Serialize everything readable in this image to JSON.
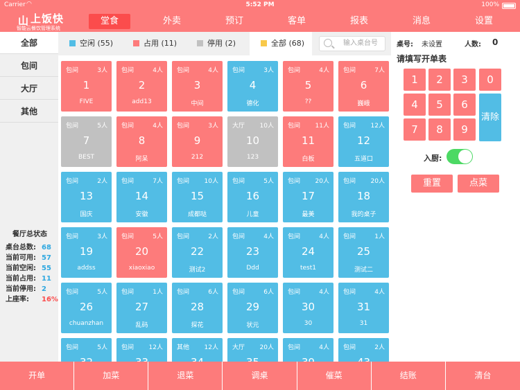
{
  "status": {
    "carrier": "Carrier",
    "time": "5:52 PM",
    "battery": "100%"
  },
  "logo": {
    "mark": "山",
    "title": "上饭快",
    "subtitle": "智能云餐饮管理系统"
  },
  "nav": [
    {
      "label": "堂食",
      "active": true
    },
    {
      "label": "外卖"
    },
    {
      "label": "预订"
    },
    {
      "label": "客单"
    },
    {
      "label": "报表"
    },
    {
      "label": "消息"
    },
    {
      "label": "设置"
    }
  ],
  "sidebar": {
    "items": [
      "全部",
      "包间",
      "大厅",
      "其他"
    ],
    "stats_title": "餐厅总状态",
    "stats": [
      {
        "label": "桌台总数:",
        "value": "68"
      },
      {
        "label": "当前可用:",
        "value": "57"
      },
      {
        "label": "当前空闲:",
        "value": "55"
      },
      {
        "label": "当前占用:",
        "value": "11"
      },
      {
        "label": "当前停用:",
        "value": "2"
      },
      {
        "label": "上座率:",
        "value": "16%"
      }
    ]
  },
  "filters": [
    {
      "label": "空闲 (55)",
      "color": "#52bde5"
    },
    {
      "label": "占用 (11)",
      "color": "#fd7b7b"
    },
    {
      "label": "停用 (2)",
      "color": "#c1c1c1"
    },
    {
      "label": "全部 (68)",
      "color": "#f8c94a"
    }
  ],
  "search": {
    "placeholder": "输入桌台号"
  },
  "tables": [
    {
      "kind": "包间",
      "seats": "3人",
      "num": "1",
      "name": "FIVE",
      "status": "busy"
    },
    {
      "kind": "包间",
      "seats": "4人",
      "num": "2",
      "name": "add13",
      "status": "busy"
    },
    {
      "kind": "包间",
      "seats": "4人",
      "num": "3",
      "name": "中间",
      "status": "busy"
    },
    {
      "kind": "包间",
      "seats": "3人",
      "num": "4",
      "name": "德化",
      "status": "free"
    },
    {
      "kind": "包间",
      "seats": "4人",
      "num": "5",
      "name": "??",
      "status": "busy"
    },
    {
      "kind": "包间",
      "seats": "7人",
      "num": "6",
      "name": "巍峨",
      "status": "busy"
    },
    {
      "kind": "包间",
      "seats": "5人",
      "num": "7",
      "name": "BEST",
      "status": "stop"
    },
    {
      "kind": "包间",
      "seats": "4人",
      "num": "8",
      "name": "阿呆",
      "status": "busy"
    },
    {
      "kind": "包间",
      "seats": "3人",
      "num": "9",
      "name": "212",
      "status": "busy"
    },
    {
      "kind": "大厅",
      "seats": "10人",
      "num": "10",
      "name": "123",
      "status": "stop"
    },
    {
      "kind": "包间",
      "seats": "11人",
      "num": "11",
      "name": "白板",
      "status": "busy"
    },
    {
      "kind": "包间",
      "seats": "12人",
      "num": "12",
      "name": "五道口",
      "status": "free"
    },
    {
      "kind": "包间",
      "seats": "2人",
      "num": "13",
      "name": "国庆",
      "status": "free"
    },
    {
      "kind": "包间",
      "seats": "7人",
      "num": "14",
      "name": "安徽",
      "status": "free"
    },
    {
      "kind": "包间",
      "seats": "10人",
      "num": "15",
      "name": "成都哒",
      "status": "free"
    },
    {
      "kind": "包间",
      "seats": "5人",
      "num": "16",
      "name": "儿童",
      "status": "free"
    },
    {
      "kind": "包间",
      "seats": "20人",
      "num": "17",
      "name": "最美",
      "status": "free"
    },
    {
      "kind": "包间",
      "seats": "20人",
      "num": "18",
      "name": "我的桌子",
      "status": "free"
    },
    {
      "kind": "包间",
      "seats": "3人",
      "num": "19",
      "name": "addss",
      "status": "free"
    },
    {
      "kind": "包间",
      "seats": "5人",
      "num": "20",
      "name": "xiaoxiao",
      "status": "busy"
    },
    {
      "kind": "包间",
      "seats": "2人",
      "num": "22",
      "name": "测试2",
      "status": "free"
    },
    {
      "kind": "包间",
      "seats": "4人",
      "num": "23",
      "name": "Ddd",
      "status": "free"
    },
    {
      "kind": "包间",
      "seats": "4人",
      "num": "24",
      "name": "test1",
      "status": "free"
    },
    {
      "kind": "包间",
      "seats": "1人",
      "num": "25",
      "name": "测试二",
      "status": "free"
    },
    {
      "kind": "包间",
      "seats": "5人",
      "num": "26",
      "name": "chuanzhan",
      "status": "free"
    },
    {
      "kind": "包间",
      "seats": "1人",
      "num": "27",
      "name": "乱码",
      "status": "free"
    },
    {
      "kind": "包间",
      "seats": "6人",
      "num": "28",
      "name": "探花",
      "status": "free"
    },
    {
      "kind": "包间",
      "seats": "6人",
      "num": "29",
      "name": "状元",
      "status": "free"
    },
    {
      "kind": "包间",
      "seats": "4人",
      "num": "30",
      "name": "30",
      "status": "free"
    },
    {
      "kind": "包间",
      "seats": "4人",
      "num": "31",
      "name": "31",
      "status": "free"
    },
    {
      "kind": "包间",
      "seats": "5人",
      "num": "32",
      "name": "",
      "status": "free"
    },
    {
      "kind": "包间",
      "seats": "12人",
      "num": "33",
      "name": "",
      "status": "free"
    },
    {
      "kind": "其他",
      "seats": "12人",
      "num": "34",
      "name": "",
      "status": "free"
    },
    {
      "kind": "大厅",
      "seats": "20人",
      "num": "35",
      "name": "",
      "status": "free"
    },
    {
      "kind": "包间",
      "seats": "4人",
      "num": "39",
      "name": "",
      "status": "free"
    },
    {
      "kind": "包间",
      "seats": "2人",
      "num": "43",
      "name": "",
      "status": "free"
    }
  ],
  "right": {
    "table_label": "桌号:",
    "table_value": "未设置",
    "people_label": "人数:",
    "people_value": "0",
    "form_title": "请填写开单表",
    "keys": [
      "1",
      "2",
      "3",
      "0",
      "4",
      "5",
      "6",
      "7",
      "8",
      "9"
    ],
    "clear_label": "清除",
    "kitchen_label": "入厨:",
    "kitchen_on": true,
    "reset_label": "重置",
    "order_label": "点菜"
  },
  "bottom": [
    "开单",
    "加菜",
    "退菜",
    "调桌",
    "催菜",
    "结账",
    "清台"
  ]
}
